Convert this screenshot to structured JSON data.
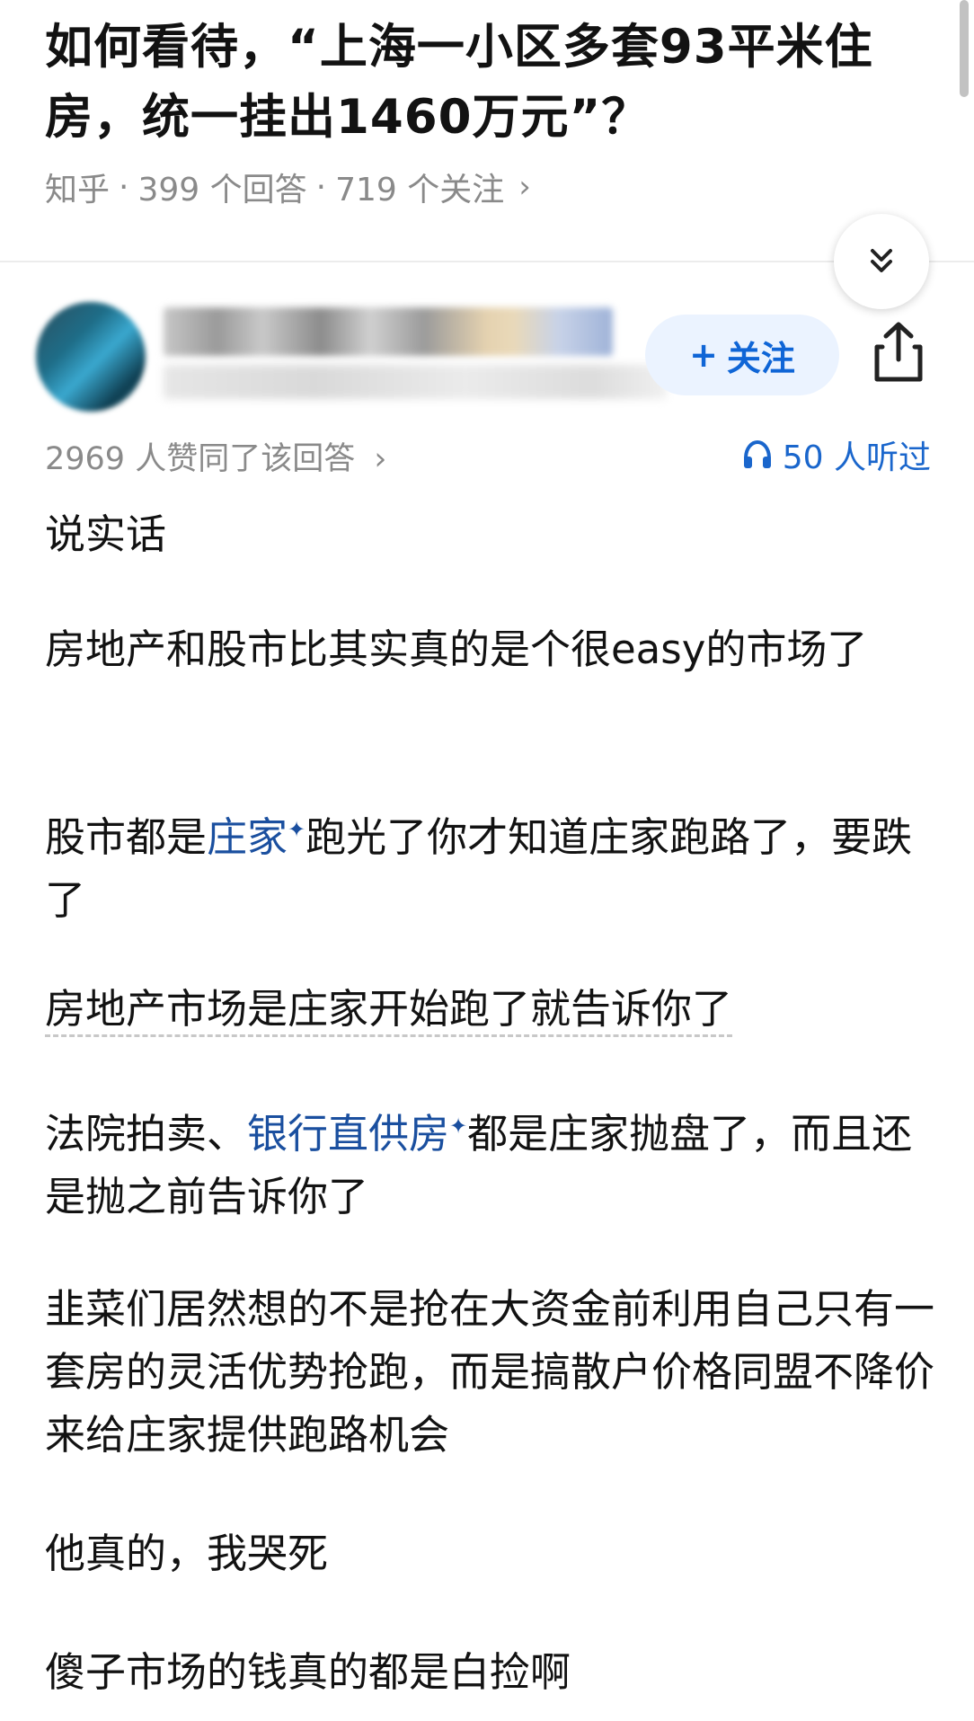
{
  "question": {
    "title": "如何看待，“上海一小区多套93平米住房，统一挂出1460万元”？",
    "source": "知乎",
    "answers": "399 个回答",
    "followers": "719 个关注",
    "meta_separator": "·",
    "chevron": "›"
  },
  "author": {
    "follow_label": "关注",
    "follow_prefix": "+"
  },
  "answer": {
    "likes_text": "2969 人赞同了该回答",
    "listen_text": "50 人听过",
    "paragraphs": {
      "p1": "说实话",
      "p2": "房地产和股市比其实真的是个很easy的市场了",
      "p3_a": "股市都是",
      "p3_link": "庄家",
      "p3_b": "跑光了你才知道庄家跑路了，要跌了",
      "p4": "房地产市场是庄家开始跑了就告诉你了",
      "p5_a": "法院拍卖、",
      "p5_link": "银行直供房",
      "p5_b": "都是庄家抛盘了，而且还是抛之前告诉你了",
      "p6": "韭菜们居然想的不是抢在大资金前利用自己只有一套房的灵活优势抢跑，而是搞散户价格同盟不降价来给庄家提供跑路机会",
      "p7": "他真的，我哭死",
      "p8": "傻子市场的钱真的都是白捡啊",
      "link_mark": "✦"
    }
  },
  "colors": {
    "link": "#1a4f9f",
    "accent": "#0f65d6",
    "muted": "#8a8a8a"
  }
}
